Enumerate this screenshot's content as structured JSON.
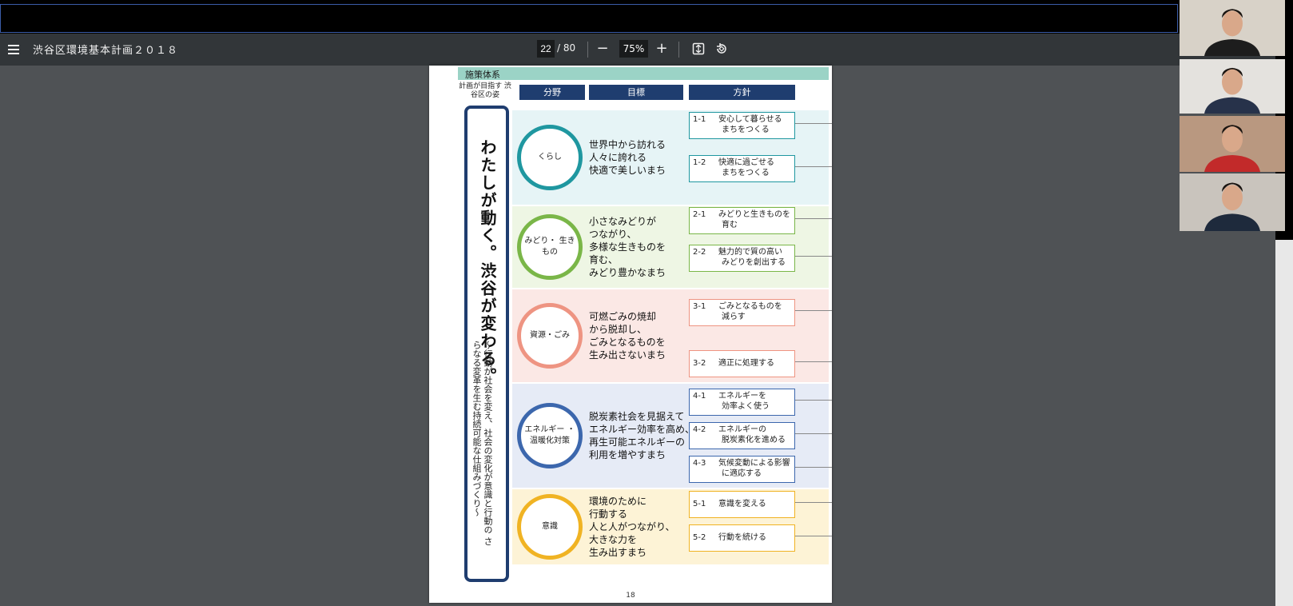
{
  "viewer": {
    "menu_icon": "menu-icon",
    "title": "渋谷区環境基本計画２０１８",
    "current_page": "22",
    "page_sep_total": "/  80",
    "zoom_out_symbol": "−",
    "zoom_level": "75%",
    "zoom_in_symbol": "+",
    "fit_icon": "fit-page-icon",
    "rotate_icon": "rotate-icon"
  },
  "doc": {
    "header": "施策体系",
    "aim_label": "計画が目指す 渋谷区の姿",
    "columns": [
      "分野",
      "目標",
      "方針"
    ],
    "vision_main": "わたしが動く。渋谷が変わる。",
    "vision_sub": "～行動が社会を変え、社会の変化が意識と行動の さらなる変革を生む持続可能な仕組みづくり～",
    "page_number": "18",
    "sections": [
      {
        "field": "くらし",
        "color": "#1f97a0",
        "band_color": "#e6f4f6",
        "goal": [
          "世界中から訪れる",
          "人々に誇れる",
          "快適で美しいまち"
        ],
        "policies": [
          {
            "num": "1-1",
            "text": [
              "安心して暮らせる",
              "まちをつくる"
            ]
          },
          {
            "num": "1-2",
            "text": [
              "快適に過ごせる",
              "まちをつくる"
            ]
          }
        ]
      },
      {
        "field": "みどり・ 生きもの",
        "color": "#7ab648",
        "band_color": "#eef6e4",
        "goal": [
          "小さなみどりが",
          "つながり、",
          "多様な生きものを",
          "育む、",
          "みどり豊かなまち"
        ],
        "policies": [
          {
            "num": "2-1",
            "text": [
              "みどりと生きものを",
              "育む"
            ]
          },
          {
            "num": "2-2",
            "text": [
              "魅力的で質の高い",
              "みどりを創出する"
            ]
          }
        ]
      },
      {
        "field": "資源・ごみ",
        "color": "#ee9482",
        "band_color": "#fbe8e5",
        "goal": [
          "可燃ごみの焼却",
          "から脱却し、",
          "ごみとなるものを",
          "生み出さないまち"
        ],
        "policies": [
          {
            "num": "3-1",
            "text": [
              "ごみとなるものを",
              "減らす"
            ]
          },
          {
            "num": "3-2",
            "text": [
              "適正に処理する"
            ]
          }
        ]
      },
      {
        "field": "エネルギー ・温暖化対策",
        "color": "#3c67ad",
        "band_color": "#e6ebf6",
        "goal": [
          "脱炭素社会を見据えて",
          "エネルギー効率を高め、",
          "再生可能エネルギーの",
          "利用を増やすまち"
        ],
        "policies": [
          {
            "num": "4-1",
            "text": [
              "エネルギーを",
              "効率よく使う"
            ]
          },
          {
            "num": "4-2",
            "text": [
              "エネルギーの",
              "脱炭素化を進める"
            ]
          },
          {
            "num": "4-3",
            "text": [
              "気候変動による影響",
              "に適応する"
            ]
          }
        ]
      },
      {
        "field": "意識",
        "color": "#f0b323",
        "band_color": "#fdf3d6",
        "goal": [
          "環境のために",
          "行動する",
          "人と人がつながり、",
          "大きな力を",
          "生み出すまち"
        ],
        "policies": [
          {
            "num": "5-1",
            "text": [
              "意識を変える"
            ]
          },
          {
            "num": "5-2",
            "text": [
              "行動を続ける"
            ]
          }
        ]
      }
    ]
  },
  "participants": [
    {
      "name": "participant-1",
      "bg": "#d8d2c8",
      "shirt": "#1d1d1d"
    },
    {
      "name": "participant-2",
      "bg": "#e4e2de",
      "shirt": "#27324a"
    },
    {
      "name": "participant-3",
      "bg": "#b99880",
      "shirt": "#c22a2a"
    },
    {
      "name": "participant-4",
      "bg": "#c9c4bd",
      "shirt": "#1e2a3c"
    }
  ]
}
